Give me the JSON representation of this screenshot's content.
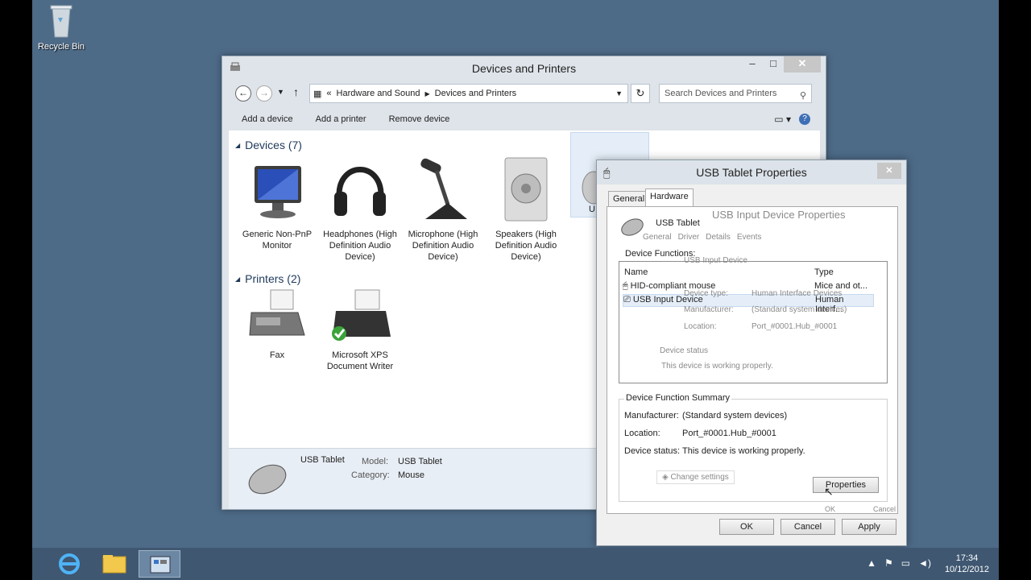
{
  "desktop": {
    "recycle_bin_label": "Recycle Bin"
  },
  "window": {
    "title": "Devices and Printers",
    "caption": {
      "minimize": "–",
      "maximize": "□",
      "close": "✕"
    },
    "breadcrumb": {
      "overflow": "«",
      "part1": "Hardware and Sound",
      "part2": "Devices and Printers"
    },
    "search_placeholder": "Search Devices and Printers",
    "commands": {
      "add_device": "Add a device",
      "add_printer": "Add a printer",
      "remove_device": "Remove device"
    },
    "devices_header": "Devices (7)",
    "devices": [
      {
        "label": "Generic Non-PnP Monitor"
      },
      {
        "label": "Headphones (High Definition Audio Device)"
      },
      {
        "label": "Microphone (High Definition Audio Device)"
      },
      {
        "label": "Speakers (High Definition Audio Device)"
      },
      {
        "label": "U"
      }
    ],
    "printers_header": "Printers (2)",
    "printers": [
      {
        "label": "Fax"
      },
      {
        "label": "Microsoft XPS Document Writer"
      }
    ],
    "details": {
      "name": "USB Tablet",
      "model_label": "Model:",
      "model_value": "USB Tablet",
      "category_label": "Category:",
      "category_value": "Mouse"
    }
  },
  "dialog": {
    "title": "USB Tablet Properties",
    "close": "✕",
    "tabs": [
      "General",
      "Hardware"
    ],
    "device_name": "USB Tablet",
    "functions_label": "Device Functions:",
    "columns": {
      "name": "Name",
      "type": "Type"
    },
    "rows": [
      {
        "name": "HID-compliant mouse",
        "type": "Mice and ot..."
      },
      {
        "name": "USB Input Device",
        "type": "Human Interf..."
      }
    ],
    "summary": {
      "legend": "Device Function Summary",
      "manufacturer_label": "Manufacturer:",
      "manufacturer_value": "(Standard system devices)",
      "location_label": "Location:",
      "location_value": "Port_#0001.Hub_#0001",
      "status_label": "Device status:",
      "status_value": "This device is working properly.",
      "change_settings": "Change settings",
      "properties": "Properties"
    },
    "ghost": {
      "title": "USB Input Device Properties",
      "tabs": [
        "General",
        "Driver",
        "Details",
        "Events"
      ],
      "device": "USB Input Device",
      "device_type_label": "Device type:",
      "device_type_value": "Human Interface Devices",
      "manufacturer_label": "Manufacturer:",
      "manufacturer_value": "(Standard system devices)",
      "location_label": "Location:",
      "location_value": "Port_#0001.Hub_#0001",
      "status_label": "Device status",
      "status_value": "This device is working properly.",
      "ok": "OK",
      "cancel": "Cancel"
    },
    "buttons": {
      "ok": "OK",
      "cancel": "Cancel",
      "apply": "Apply"
    }
  },
  "tray": {
    "time": "17:34",
    "date": "10/12/2012"
  }
}
